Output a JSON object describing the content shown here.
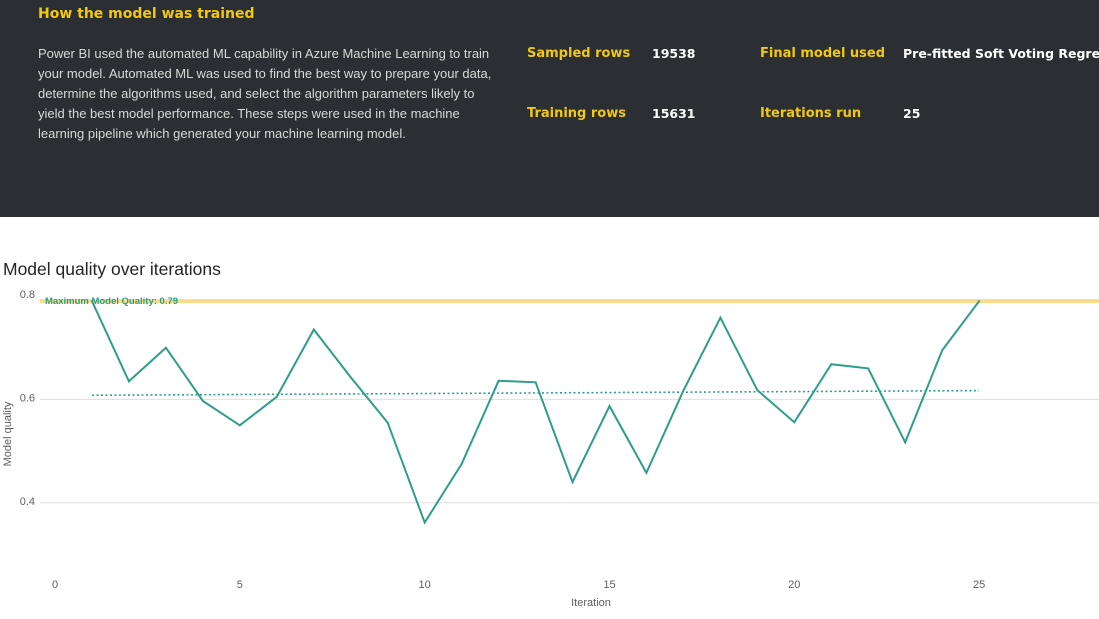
{
  "summary": {
    "title": "How the model was trained",
    "description": "Power BI used the automated ML capability in Azure Machine Learning to train your model. Automated ML was used to find the best way to prepare your data, determine the algorithms used, and select the algorithm parameters likely to yield the best model performance. These steps were used in the machine learning pipeline which generated your machine learning model.",
    "sampled_rows_label": "Sampled rows",
    "sampled_rows_value": "19538",
    "training_rows_label": "Training rows",
    "training_rows_value": "15631",
    "final_model_label": "Final model used",
    "final_model_value": "Pre-fitted Soft Voting Regressor",
    "iterations_label": "Iterations run",
    "iterations_value": "25"
  },
  "colors": {
    "panel_bg": "#2b2f33",
    "accent_yellow": "#f2c811",
    "series_line": "#2e9e8a",
    "max_line": "#f7dc8a",
    "gridline": "#e1dfdd"
  },
  "chart_data": {
    "type": "line",
    "title": "Model quality over iterations",
    "xlabel": "Iteration",
    "ylabel": "Model quality",
    "xlim": [
      0,
      29
    ],
    "ylim": [
      0.33,
      0.8
    ],
    "x_ticks": [
      0,
      5,
      10,
      15,
      20,
      25
    ],
    "y_ticks": [
      0.4,
      0.6,
      0.8
    ],
    "grid": true,
    "series": [
      {
        "x": [
          1,
          2,
          3,
          4,
          5,
          6,
          7,
          8,
          9,
          10,
          11,
          12,
          13,
          14,
          15,
          16,
          17,
          18,
          19,
          20,
          21,
          22,
          23,
          24,
          25
        ],
        "values": [
          0.79,
          0.635,
          0.7,
          0.597,
          0.55,
          0.605,
          0.735,
          0.643,
          0.555,
          0.362,
          0.475,
          0.636,
          0.633,
          0.44,
          0.587,
          0.458,
          0.617,
          0.758,
          0.618,
          0.556,
          0.668,
          0.66,
          0.517,
          0.695,
          0.79
        ]
      }
    ],
    "trendline": {
      "x": [
        1,
        25
      ],
      "values": [
        0.608,
        0.617
      ]
    },
    "reference_line": {
      "value": 0.79,
      "label": "Maximum Model Quality: 0.79"
    }
  }
}
